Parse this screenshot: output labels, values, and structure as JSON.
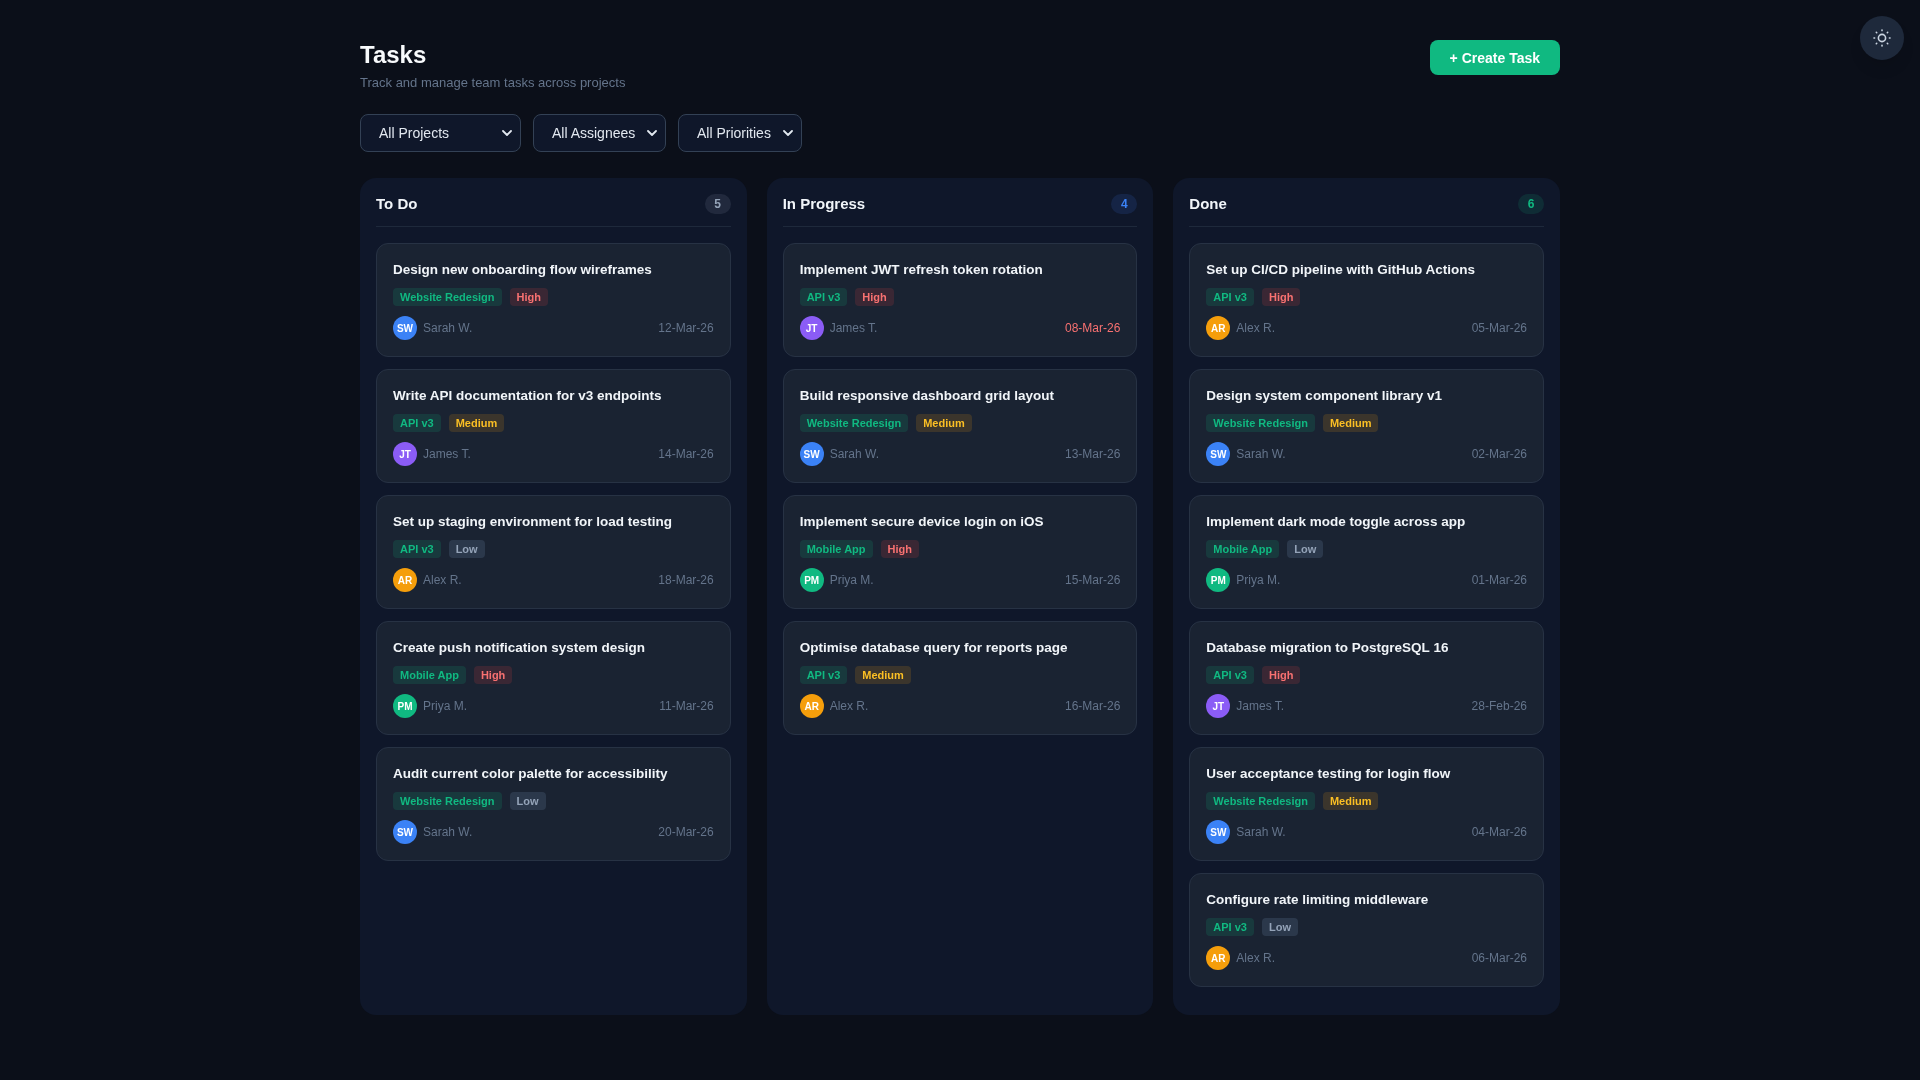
{
  "header": {
    "title": "Tasks",
    "subtitle": "Track and manage team tasks across projects",
    "create_button": "+ Create Task"
  },
  "filters": [
    {
      "label": "All Projects"
    },
    {
      "label": "All Assignees"
    },
    {
      "label": "All Priorities"
    }
  ],
  "columns": [
    {
      "title": "To Do",
      "count": "5",
      "color": "#94a3b8",
      "cards": [
        {
          "title": "Design new onboarding flow wireframes",
          "project": "Website Redesign",
          "priority": {
            "label": "High",
            "kind": "high"
          },
          "assignee": {
            "initials": "SW",
            "name": "Sarah W.",
            "color": "#3b82f6"
          },
          "due": "12-Mar-26",
          "overdue": false
        },
        {
          "title": "Write API documentation for v3 endpoints",
          "project": "API v3",
          "priority": {
            "label": "Medium",
            "kind": "medium"
          },
          "assignee": {
            "initials": "JT",
            "name": "James T.",
            "color": "#8b5cf6"
          },
          "due": "14-Mar-26",
          "overdue": false
        },
        {
          "title": "Set up staging environment for load testing",
          "project": "API v3",
          "priority": {
            "label": "Low",
            "kind": "low"
          },
          "assignee": {
            "initials": "AR",
            "name": "Alex R.",
            "color": "#f59e0b"
          },
          "due": "18-Mar-26",
          "overdue": false
        },
        {
          "title": "Create push notification system design",
          "project": "Mobile App",
          "priority": {
            "label": "High",
            "kind": "high"
          },
          "assignee": {
            "initials": "PM",
            "name": "Priya M.",
            "color": "#10b981"
          },
          "due": "11-Mar-26",
          "overdue": false
        },
        {
          "title": "Audit current color palette for accessibility",
          "project": "Website Redesign",
          "priority": {
            "label": "Low",
            "kind": "low"
          },
          "assignee": {
            "initials": "SW",
            "name": "Sarah W.",
            "color": "#3b82f6"
          },
          "due": "20-Mar-26",
          "overdue": false
        }
      ]
    },
    {
      "title": "In Progress",
      "count": "4",
      "color": "#3b82f6",
      "cards": [
        {
          "title": "Implement JWT refresh token rotation",
          "project": "API v3",
          "priority": {
            "label": "High",
            "kind": "high"
          },
          "assignee": {
            "initials": "JT",
            "name": "James T.",
            "color": "#8b5cf6"
          },
          "due": "08-Mar-26",
          "overdue": true
        },
        {
          "title": "Build responsive dashboard grid layout",
          "project": "Website Redesign",
          "priority": {
            "label": "Medium",
            "kind": "medium"
          },
          "assignee": {
            "initials": "SW",
            "name": "Sarah W.",
            "color": "#3b82f6"
          },
          "due": "13-Mar-26",
          "overdue": false
        },
        {
          "title": "Implement secure device login on iOS",
          "project": "Mobile App",
          "priority": {
            "label": "High",
            "kind": "high"
          },
          "assignee": {
            "initials": "PM",
            "name": "Priya M.",
            "color": "#10b981"
          },
          "due": "15-Mar-26",
          "overdue": false
        },
        {
          "title": "Optimise database query for reports page",
          "project": "API v3",
          "priority": {
            "label": "Medium",
            "kind": "medium"
          },
          "assignee": {
            "initials": "AR",
            "name": "Alex R.",
            "color": "#f59e0b"
          },
          "due": "16-Mar-26",
          "overdue": false
        }
      ]
    },
    {
      "title": "Done",
      "count": "6",
      "color": "#10b981",
      "cards": [
        {
          "title": "Set up CI/CD pipeline with GitHub Actions",
          "project": "API v3",
          "priority": {
            "label": "High",
            "kind": "high"
          },
          "assignee": {
            "initials": "AR",
            "name": "Alex R.",
            "color": "#f59e0b"
          },
          "due": "05-Mar-26",
          "overdue": false
        },
        {
          "title": "Design system component library v1",
          "project": "Website Redesign",
          "priority": {
            "label": "Medium",
            "kind": "medium"
          },
          "assignee": {
            "initials": "SW",
            "name": "Sarah W.",
            "color": "#3b82f6"
          },
          "due": "02-Mar-26",
          "overdue": false
        },
        {
          "title": "Implement dark mode toggle across app",
          "project": "Mobile App",
          "priority": {
            "label": "Low",
            "kind": "low"
          },
          "assignee": {
            "initials": "PM",
            "name": "Priya M.",
            "color": "#10b981"
          },
          "due": "01-Mar-26",
          "overdue": false
        },
        {
          "title": "Database migration to PostgreSQL 16",
          "project": "API v3",
          "priority": {
            "label": "High",
            "kind": "high"
          },
          "assignee": {
            "initials": "JT",
            "name": "James T.",
            "color": "#8b5cf6"
          },
          "due": "28-Feb-26",
          "overdue": false
        },
        {
          "title": "User acceptance testing for login flow",
          "project": "Website Redesign",
          "priority": {
            "label": "Medium",
            "kind": "medium"
          },
          "assignee": {
            "initials": "SW",
            "name": "Sarah W.",
            "color": "#3b82f6"
          },
          "due": "04-Mar-26",
          "overdue": false
        },
        {
          "title": "Configure rate limiting middleware",
          "project": "API v3",
          "priority": {
            "label": "Low",
            "kind": "low"
          },
          "assignee": {
            "initials": "AR",
            "name": "Alex R.",
            "color": "#f59e0b"
          },
          "due": "06-Mar-26",
          "overdue": false
        }
      ]
    }
  ]
}
